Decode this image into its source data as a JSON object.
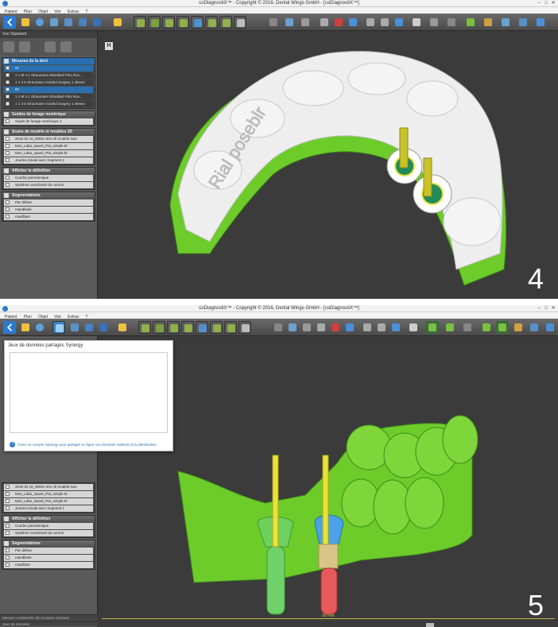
{
  "figure4": {
    "title": "coDiagnostiX™ - Copyright © 2016, Dental Wings GmbH - [coDiagnostiX™]",
    "menu": [
      "Patient",
      "Plan",
      "Objet",
      "Voir",
      "Extras",
      "?"
    ],
    "panel_header": "Standard",
    "implants": {
      "header": "Mesures de la dent",
      "groups": [
        {
          "label": "#1",
          "items": [
            "1   1   M   4.1   Straumann Standard Plus Rou...",
            "1   1   3   5   Straumann Guided Surgery 1 sleeve"
          ]
        },
        {
          "label": "#2",
          "items": [
            "1   1   M   4.1   Straumann Standard Plus Rou...",
            "1   1   3   5   Straumann Guided Surgery 1 sleeve"
          ]
        }
      ]
    },
    "guide_section": {
      "header": "Guides de forage numérique",
      "items": [
        "Guide de forage numérique 1"
      ]
    },
    "scans_section": {
      "header": "Scans de modèle et modèles 3D",
      "items": [
        "2015 02 10_00001 001 All modèle lose",
        "Mon_Labo_sauvé_Pat_simple t0",
        "Mon_Labo_sauvé_Pat_simple t0",
        "Jeu/reo travail avec Segment 1"
      ]
    },
    "display_section": {
      "header": "Afficher la définition",
      "items": [
        "Courbe panoramique",
        "Système coordonné du corrvoi"
      ]
    },
    "segmentation_section": {
      "header": "Segmentations",
      "items": [
        "Par défaut",
        "mandibule",
        "maxillaire"
      ]
    },
    "viewport": {
      "text_on_guide": "Rial poseblr",
      "figure_number": "4",
      "view_icon_label": "H"
    }
  },
  "figure5": {
    "title": "coDiagnostiX™ - Copyright © 2016, Dental Wings GmbH - [coDiagnostiX™]",
    "menu": [
      "Patient",
      "Plan",
      "Objet",
      "Voir",
      "Extras",
      "?"
    ],
    "popup": {
      "title": "Jeux de données partagés Synergy",
      "note": "Créer un compte Synergy pour partager en ligne vos données relatives à la planification."
    },
    "scans_section": {
      "items": [
        "2015 02 10_00001 001 All modèle lose",
        "Mon_Labo_sauvé_Pat_simple t0",
        "Mon_Labo_sauvé_Pat_simple t0",
        "Jeu/reo travail avec Segment 1"
      ]
    },
    "display_section": {
      "header": "Afficher la définition",
      "items": [
        "Courbe panoramique",
        "Système coordonné du corrvoi"
      ]
    },
    "segmentation_section": {
      "header": "Segmentations",
      "items": [
        "Par défaut",
        "mandibule",
        "maxillaire"
      ]
    },
    "status": [
      "Mesure coordonnée 3D et autres mesures",
      "Jeux de données"
    ],
    "scale_label": "50 mm",
    "figure_number": "5"
  },
  "colors": {
    "model_green": "#6dcc2a",
    "guide_white": "#eeeeee",
    "implant_yellow": "#e8e23a",
    "accent_blue": "#2a6fb0",
    "crown_blue": "#4aa3e8",
    "implant_red": "#e85a5a",
    "implant_green": "#6fd26a"
  }
}
